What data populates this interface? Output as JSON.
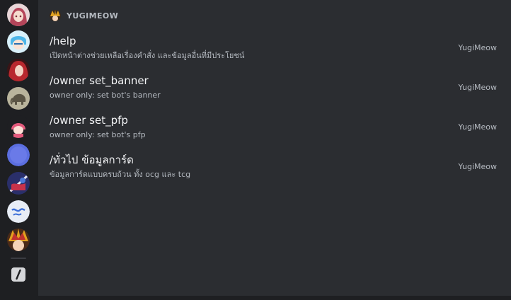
{
  "servers": [
    {
      "icon": "anime-girl-red-hair-avatar-icon",
      "color": "#c46a7a"
    },
    {
      "icon": "blue-character-avatar-icon",
      "color": "#5ec0e8"
    },
    {
      "icon": "red-haired-character-avatar-icon",
      "color": "#a8282e"
    },
    {
      "icon": "elephant-avatar-icon",
      "color": "#b7b29a"
    },
    {
      "icon": "pink-character-avatar-icon",
      "color": "#e0607e"
    },
    {
      "icon": "blue-circle-server-icon",
      "color": "#5865f2"
    },
    {
      "icon": "sword-character-avatar-icon",
      "color": "#3b4a9c"
    },
    {
      "icon": "wave-logo-server-icon",
      "color": "#e6ebf5"
    },
    {
      "icon": "yugioh-character-avatar-icon",
      "color": "#e2a020"
    }
  ],
  "app_commands_icon": "slash-command-icon",
  "section": {
    "title": "YUGIMEOW",
    "avatar_icon": "bot-avatar-icon"
  },
  "commands": [
    {
      "name": "/help",
      "description": "เปิดหน้าต่างช่วยเหลือเรื่องคำสั่ง และข้อมูลอื่นที่มีประโยชน์",
      "source": "YugiMeow"
    },
    {
      "name": "/owner set_banner",
      "description": "owner only: set bot's banner",
      "source": "YugiMeow"
    },
    {
      "name": "/owner set_pfp",
      "description": "owner only: set bot's pfp",
      "source": "YugiMeow"
    },
    {
      "name": "/ทั่วไป ข้อมูลการ์ด",
      "description": "ข้อมูลการ์ดแบบครบถ้วน ทั้ง ocg และ tcg",
      "source": "YugiMeow"
    }
  ],
  "colors": {
    "background": "#2b2d31",
    "rail": "#1e1f22",
    "text_primary": "#f2f3f5",
    "text_muted": "#b5bac1"
  }
}
